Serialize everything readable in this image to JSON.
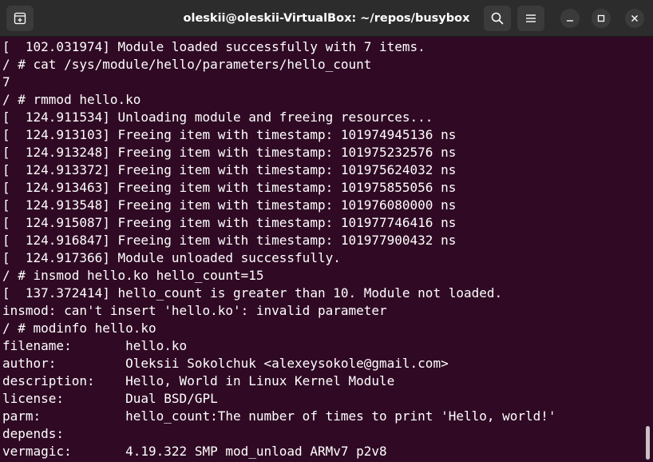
{
  "window": {
    "title": "oleskii@oleskii-VirtualBox: ~/repos/busybox"
  },
  "icons": {
    "new_tab": "new-tab-icon",
    "search": "search-icon",
    "menu": "hamburger-menu-icon",
    "minimize": "minimize-icon",
    "maximize": "maximize-icon",
    "close": "close-icon"
  },
  "colors": {
    "background": "#300a24",
    "titlebar": "#2c2c2c",
    "text": "#ffffff"
  },
  "terminal": {
    "lines": [
      "[  102.031974] Module loaded successfully with 7 items.",
      "/ # cat /sys/module/hello/parameters/hello_count",
      "7",
      "/ # rmmod hello.ko",
      "[  124.911534] Unloading module and freeing resources...",
      "[  124.913103] Freeing item with timestamp: 101974945136 ns",
      "[  124.913248] Freeing item with timestamp: 101975232576 ns",
      "[  124.913372] Freeing item with timestamp: 101975624032 ns",
      "[  124.913463] Freeing item with timestamp: 101975855056 ns",
      "[  124.913548] Freeing item with timestamp: 101976080000 ns",
      "[  124.915087] Freeing item with timestamp: 101977746416 ns",
      "[  124.916847] Freeing item with timestamp: 101977900432 ns",
      "[  124.917366] Module unloaded successfully.",
      "/ # insmod hello.ko hello_count=15",
      "[  137.372414] hello_count is greater than 10. Module not loaded.",
      "insmod: can't insert 'hello.ko': invalid parameter",
      "/ # modinfo hello.ko",
      "filename:       hello.ko",
      "author:         Oleksii Sokolchuk <alexeysokole@gmail.com>",
      "description:    Hello, World in Linux Kernel Module",
      "license:        Dual BSD/GPL",
      "parm:           hello_count:The number of times to print 'Hello, world!'",
      "depends:",
      "vermagic:       4.19.322 SMP mod_unload ARMv7 p2v8"
    ]
  }
}
